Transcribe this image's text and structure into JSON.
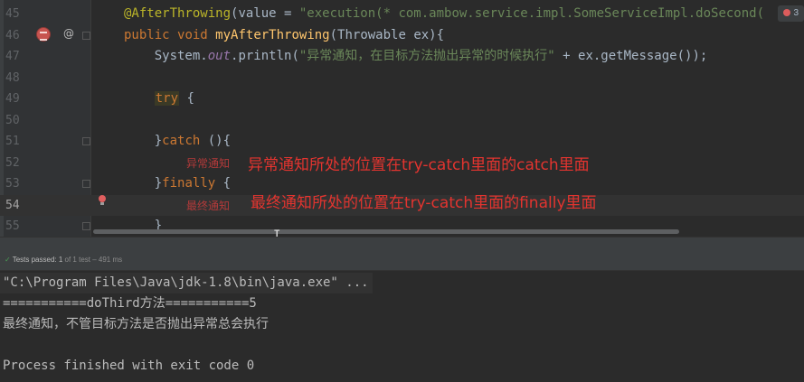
{
  "editor": {
    "inspection": {
      "count": "3"
    },
    "lines": [
      {
        "number": "45",
        "tokens": [
          {
            "t": "@AfterThrowing",
            "c": "ann"
          },
          {
            "t": "(value = ",
            "c": "plain"
          },
          {
            "t": "\"execution(* com.ambow.service.impl.SomeServiceImpl.doSecond(",
            "c": "str"
          }
        ]
      },
      {
        "number": "46",
        "tokens": [
          {
            "t": "public ",
            "c": "kw"
          },
          {
            "t": "void ",
            "c": "kw"
          },
          {
            "t": "myAfterThrowing",
            "c": "fn"
          },
          {
            "t": "(Throwable ex){",
            "c": "plain"
          }
        ]
      },
      {
        "number": "47",
        "tokens": [
          {
            "t": "    System.",
            "c": "plain"
          },
          {
            "t": "out",
            "c": "italic-field"
          },
          {
            "t": ".println(",
            "c": "plain"
          },
          {
            "t": "\"异常通知，在目标方法抛出异常的时候执行\"",
            "c": "str"
          },
          {
            "t": " + ex.getMessage());",
            "c": "plain"
          }
        ]
      },
      {
        "number": "48",
        "tokens": []
      },
      {
        "number": "49",
        "tokens": [
          {
            "t": "    ",
            "c": "plain"
          },
          {
            "t": "try",
            "c": "kw try-hl"
          },
          {
            "t": " {",
            "c": "plain"
          }
        ]
      },
      {
        "number": "50",
        "tokens": []
      },
      {
        "number": "51",
        "tokens": [
          {
            "t": "    }",
            "c": "plain"
          },
          {
            "t": "catch",
            "c": "kw"
          },
          {
            "t": " (){",
            "c": "plain"
          }
        ]
      },
      {
        "number": "52",
        "tokens": []
      },
      {
        "number": "53",
        "tokens": [
          {
            "t": "    }",
            "c": "plain"
          },
          {
            "t": "finally",
            "c": "kw"
          },
          {
            "t": " {",
            "c": "plain"
          }
        ]
      },
      {
        "number": "54",
        "tokens": []
      },
      {
        "number": "55",
        "tokens": [
          {
            "t": "    }",
            "c": "plain"
          }
        ]
      }
    ],
    "annotations": {
      "catch_tag": "异常通知",
      "catch_note": "异常通知所处的位置在try-catch里面的catch里面",
      "finally_tag": "最终通知",
      "finally_note": "最终通知所处的位置在try-catch里面的finally里面"
    }
  },
  "test_status": {
    "label": "Tests passed: 1",
    "detail": "of 1 test – 491 ms"
  },
  "console": {
    "lines": [
      "\"C:\\Program Files\\Java\\jdk-1.8\\bin\\java.exe\" ...",
      "===========doThird方法===========5",
      "最终通知，不管目标方法是否抛出异常总会执行",
      "",
      "Process finished with exit code 0"
    ]
  },
  "colors": {
    "editor_bg": "#2b2b2b",
    "keyword": "#cc7832",
    "annotation": "#bbb529",
    "string": "#6a8759",
    "method": "#ffc66d",
    "note_red": "#e3342f"
  }
}
